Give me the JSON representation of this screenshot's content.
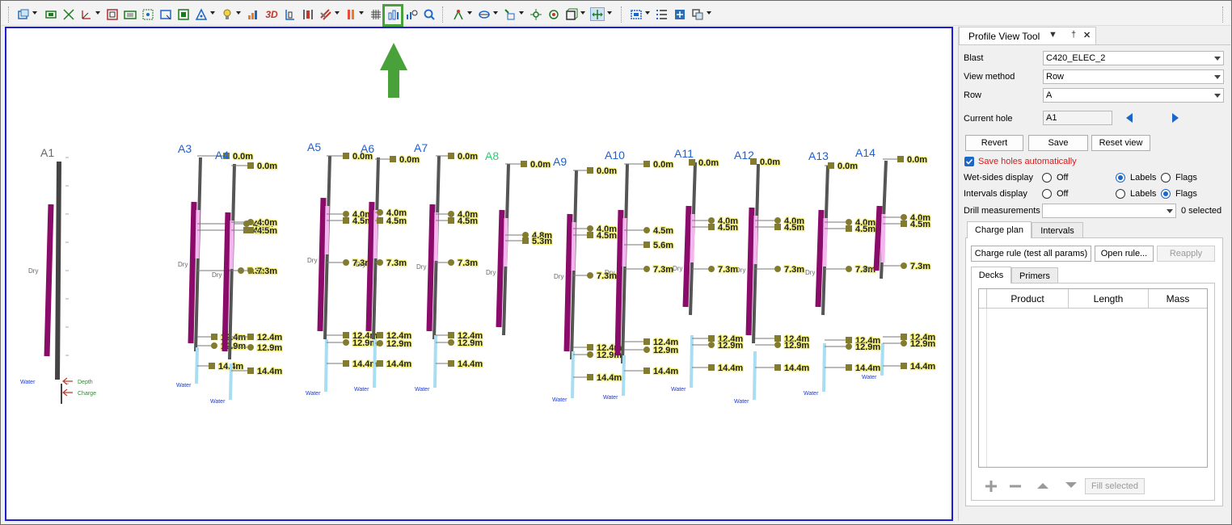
{
  "toolbar": {
    "icons": [
      "window-layout-icon",
      "select-box-icon",
      "resize-icon",
      "axis-tool-icon",
      "frame-icon",
      "frame-select-icon",
      "snap-icon",
      "window-icon",
      "measure-icon",
      "triangle-tool-icon",
      "lightbulb-icon",
      "bar-chart-icon",
      "text-3d-icon",
      "section-icon",
      "bracket-icon",
      "layers-icon",
      "color-ramp-icon",
      "grid-icon",
      "profile-view-tool-icon",
      "zoom-chart-icon",
      "search-icon",
      "network-icon",
      "cloud-icon",
      "points-icon",
      "flow-icon",
      "cluster-icon",
      "box-icon",
      "align-icon",
      "dashed-select-icon",
      "list-icon",
      "move-icon",
      "copy-icon"
    ],
    "label_3d": "3D",
    "highlight_color": "#49a13a"
  },
  "viewport": {
    "border_color": "#1d1dd6",
    "hole_names": [
      "A1",
      "A3",
      "A4",
      "A5",
      "A6",
      "A7",
      "A8",
      "A9",
      "A10",
      "A11",
      "A12",
      "A13",
      "A14"
    ],
    "depth_labels": [
      "0.0m",
      "4.0m",
      "4.5m",
      "7.3m",
      "12.4m",
      "12.9m",
      "14.4m",
      "4.8m",
      "5.3m",
      "5.6m"
    ],
    "dry_label": "Dry",
    "water_label": "Water",
    "legend_depth": "Depth",
    "legend_charge": "Charge"
  },
  "panel": {
    "title": "Profile View Tool",
    "fields": {
      "blast_label": "Blast",
      "blast_value": "C420_ELEC_2",
      "view_method_label": "View method",
      "view_method_value": "Row",
      "row_label": "Row",
      "row_value": "A",
      "current_hole_label": "Current hole",
      "current_hole_value": "A1"
    },
    "buttons": {
      "revert": "Revert",
      "save": "Save",
      "reset_view": "Reset view"
    },
    "save_auto_label": "Save holes automatically",
    "wet_sides_label": "Wet-sides display",
    "intervals_display_label": "Intervals display",
    "off_label": "Off",
    "labels_label": "Labels",
    "flags_label": "Flags",
    "drill_measurements_label": "Drill measurements",
    "drill_selected": "0 selected",
    "tabs": {
      "charge_plan": "Charge plan",
      "intervals": "Intervals"
    },
    "charge_buttons": {
      "charge_rule": "Charge rule (test all params)",
      "open_rule": "Open rule...",
      "reapply": "Reapply"
    },
    "subtabs": {
      "decks": "Decks",
      "primers": "Primers"
    },
    "table_headers": [
      "Product",
      "Length",
      "Mass"
    ],
    "fill_selected": "Fill selected"
  }
}
